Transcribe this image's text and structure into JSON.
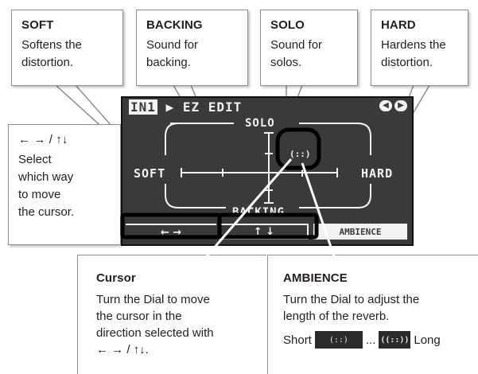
{
  "callouts": {
    "soft": {
      "title": "SOFT",
      "desc": "Softens the\ndistortion."
    },
    "backing": {
      "title": "BACKING",
      "desc": "Sound for\nbacking."
    },
    "solo": {
      "title": "SOLO",
      "desc": "Sound for\nsolos."
    },
    "hard": {
      "title": "HARD",
      "desc": "Hardens the\ndistortion."
    },
    "select": {
      "title": "← → / ↑↓",
      "desc": "Select\nwhich way\nto move\nthe cursor."
    },
    "cursor": {
      "title": "Cursor",
      "desc": "Turn the Dial to move\nthe cursor in the\ndirection selected with\n← → / ↑↓."
    },
    "ambience": {
      "title": "AMBIENCE",
      "desc": "Turn the Dial to adjust the\nlength of the reverb.",
      "short_label": "Short",
      "ellipsis": "...",
      "long_label": "Long"
    }
  },
  "lcd": {
    "header_in": "IN1",
    "header_title": "EZ EDIT",
    "solo": "SOLO",
    "soft": "SOFT",
    "hard": "HARD",
    "backing": "BACKING",
    "bar_lr": "← →",
    "bar_ud": "↑ ↓",
    "bar_ambience": "AMBIENCE",
    "cursor_glyph": "(::)",
    "amb_short_glyph": "(::)",
    "amb_long_glyph": "((::))"
  },
  "colors": {
    "lcd_background": "#3a3a3a",
    "lcd_foreground": "#f2f2f2",
    "callout_border": "#8f8f8f"
  }
}
